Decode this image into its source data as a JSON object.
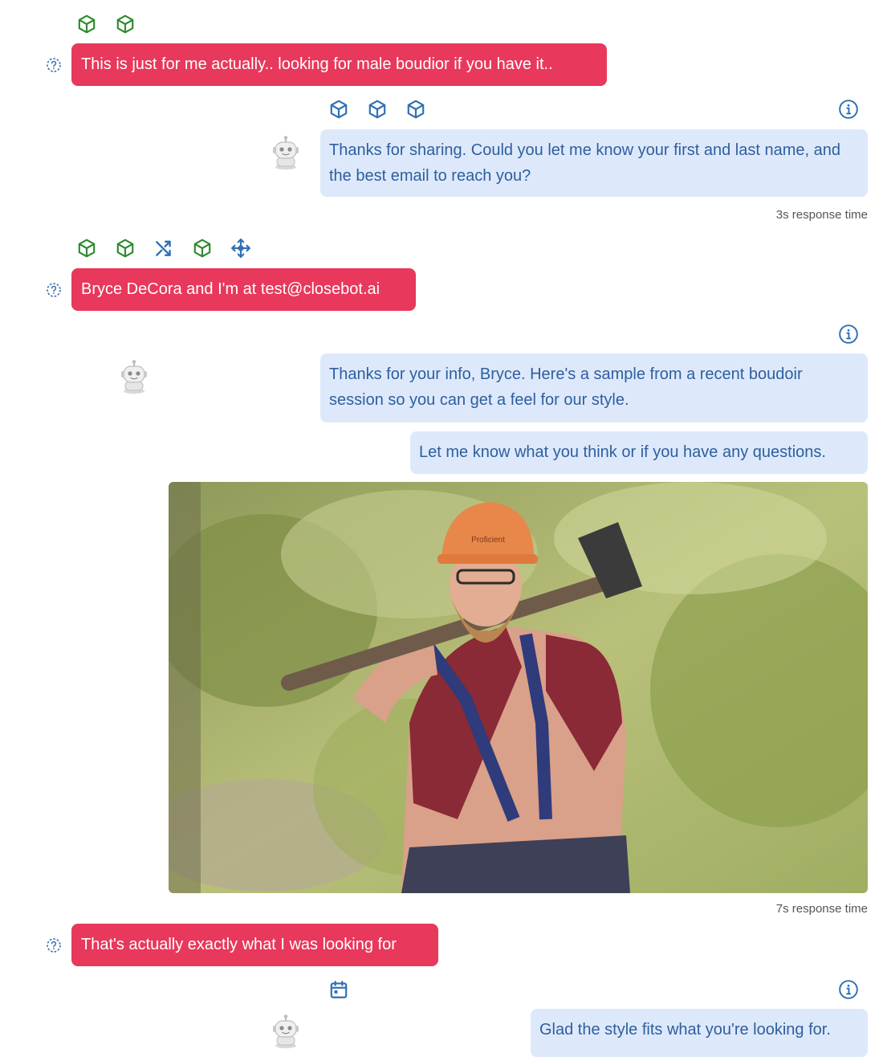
{
  "messages": [
    {
      "role": "user",
      "text": "This is just for me actually.. looking for male boudior if you have it.."
    },
    {
      "role": "bot",
      "text": "Thanks for sharing. Could you let me know your first and last name, and the best email to reach you?",
      "response_time": "3s response time"
    },
    {
      "role": "user",
      "text": "Bryce DeCora and I'm at test@closebot.ai"
    },
    {
      "role": "bot",
      "text": "Thanks for your info, Bryce. Here's a sample from a recent boudoir session so you can get a feel for our style."
    },
    {
      "role": "bot",
      "text": "Let me know what you think or if you have any questions."
    },
    {
      "role": "bot",
      "type": "image",
      "response_time": "7s response time",
      "image_caption_text": "Proficient"
    },
    {
      "role": "user",
      "text": "That's actually exactly what I was looking for"
    },
    {
      "role": "bot",
      "text": "Glad the style fits what you're looking for."
    }
  ],
  "action_icons": {
    "row1": [
      "cube-icon",
      "cube-icon"
    ],
    "row2": [
      "cube-icon",
      "cube-icon",
      "cube-icon"
    ],
    "row3": [
      "cube-icon",
      "cube-icon",
      "shuffle-icon",
      "cube-icon",
      "move-icon"
    ],
    "row4": [
      "calendar-icon"
    ]
  },
  "colors": {
    "user_bubble": "#e8385c",
    "bot_bubble": "#dde9fb",
    "bot_text": "#2f5e9e",
    "action_green": "#2e8b2e",
    "action_blue": "#2f6fb5"
  }
}
